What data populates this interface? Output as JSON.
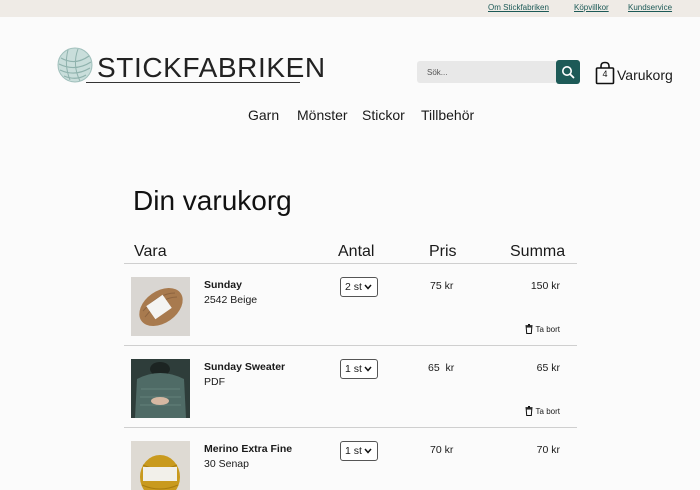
{
  "topbar": {
    "links": [
      "Om Stickfabriken",
      "Köpvillkor",
      "Kundservice"
    ]
  },
  "header": {
    "logo_text": "STICKFABRIKEN",
    "search_placeholder": "Sök...",
    "cart_count": "4",
    "cart_label": "Varukorg"
  },
  "nav": {
    "items": [
      "Garn",
      "Mönster",
      "Stickor",
      "Tillbehör"
    ]
  },
  "cart_page": {
    "title": "Din varukorg",
    "columns": {
      "item": "Vara",
      "quantity": "Antal",
      "price": "Pris",
      "total": "Summa"
    },
    "remove_label": "Ta bort",
    "rows": [
      {
        "name": "Sunday",
        "variant": "2542 Beige",
        "quantity": "2 st",
        "price": "75 kr",
        "total": "150 kr",
        "image": "beige-yarn-skein"
      },
      {
        "name": "Sunday Sweater",
        "variant": "PDF",
        "quantity": "1 st",
        "price": "65  kr",
        "total": "65 kr",
        "image": "green-sweater-photo"
      },
      {
        "name": "Merino Extra Fine",
        "variant": "30 Senap",
        "quantity": "1 st",
        "price": "70 kr",
        "total": "70 kr",
        "image": "mustard-yarn-skein"
      }
    ]
  },
  "colors": {
    "brand_teal": "#1d5a57",
    "topbar_bg": "#efebe6",
    "page_bg": "#fbfbfb"
  }
}
